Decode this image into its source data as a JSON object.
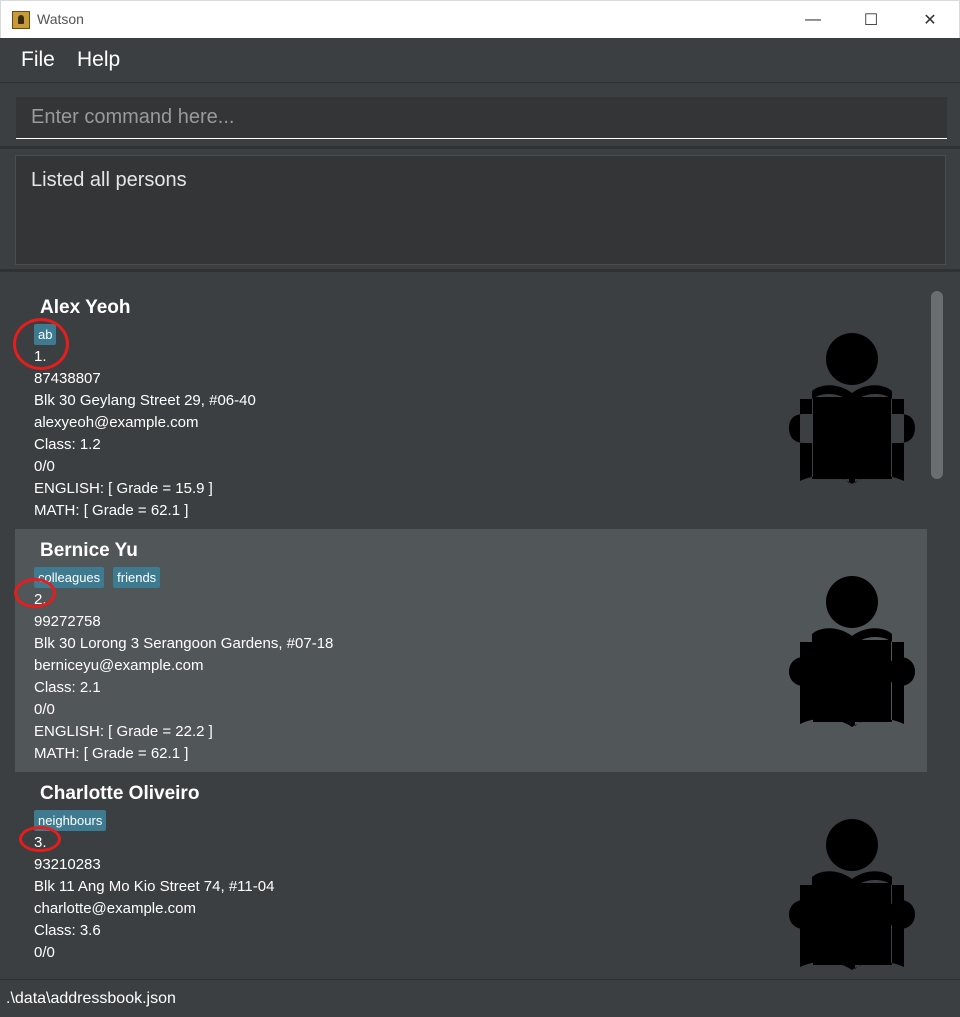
{
  "window": {
    "title": "Watson",
    "minimize_glyph": "—",
    "maximize_glyph": "☐",
    "close_glyph": "✕"
  },
  "menu": {
    "items": [
      "File",
      "Help"
    ]
  },
  "command": {
    "placeholder": "Enter command here..."
  },
  "result": {
    "text": "Listed all persons"
  },
  "persons": [
    {
      "name": "Alex Yeoh",
      "tags": [
        "ab"
      ],
      "index": "1.",
      "phone": "87438807",
      "address": "Blk 30 Geylang Street 29, #06-40",
      "email": "alexyeoh@example.com",
      "class": "Class: 1.2",
      "attendance": "0/0",
      "english": "ENGLISH: [ Grade = 15.9 ]",
      "math": "MATH: [ Grade = 62.1 ]"
    },
    {
      "name": "Bernice Yu",
      "tags": [
        "colleagues",
        "friends"
      ],
      "index": "2.",
      "phone": "99272758",
      "address": "Blk 30 Lorong 3 Serangoon Gardens, #07-18",
      "email": "berniceyu@example.com",
      "class": "Class: 2.1",
      "attendance": "0/0",
      "english": "ENGLISH: [ Grade = 22.2 ]",
      "math": "MATH: [ Grade = 62.1 ]"
    },
    {
      "name": "Charlotte Oliveiro",
      "tags": [
        "neighbours"
      ],
      "index": "3.",
      "phone": "93210283",
      "address": "Blk 11 Ang Mo Kio Street 74, #11-04",
      "email": "charlotte@example.com",
      "class": "Class: 3.6",
      "attendance": "0/0"
    }
  ],
  "avatar_icon": "reader-icon",
  "colors": {
    "tag": "#3e7b91",
    "annotation": "#e51d1d",
    "background": "#3c3f41",
    "selected_card": "#515658"
  },
  "status": {
    "path": ".\\data\\addressbook.json"
  }
}
